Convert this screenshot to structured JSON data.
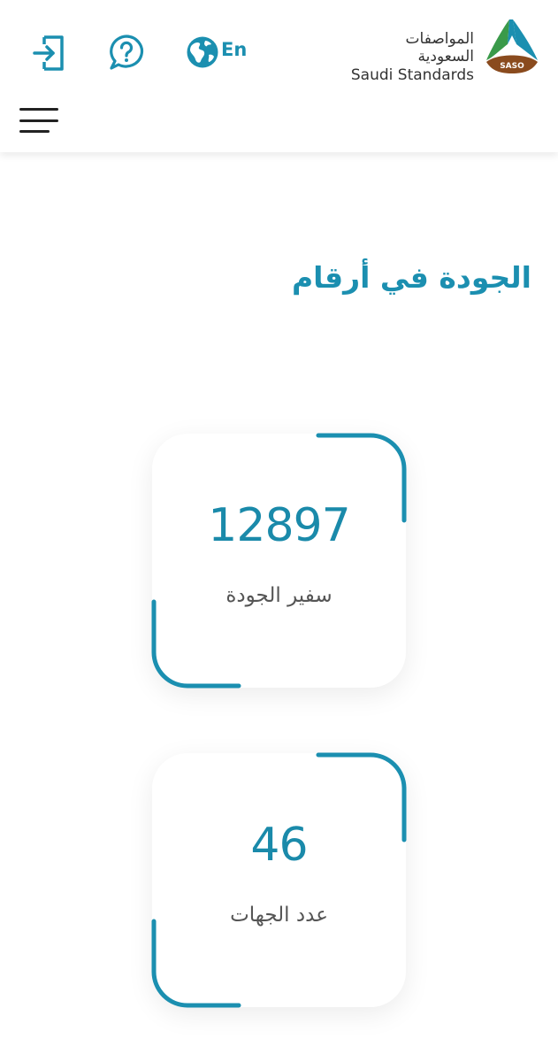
{
  "header": {
    "logo": {
      "arabic_name": "المواصفات السعودية",
      "english_name": "Saudi Standards",
      "badge_text": "SASO"
    },
    "language_toggle_label": "En",
    "icons": {
      "login": "login-icon",
      "help": "help-chat-icon",
      "language": "globe-icon",
      "menu": "hamburger-menu-icon"
    }
  },
  "section": {
    "title": "الجودة في أرقام"
  },
  "stats": [
    {
      "value": "12897",
      "label": "سفير الجودة"
    },
    {
      "value": "46",
      "label": "عدد الجهات"
    }
  ],
  "colors": {
    "accent": "#1b8fb0",
    "text_dark": "#555555",
    "logo_green": "#3a9a4a",
    "logo_blue": "#1b8fb0",
    "logo_brown": "#8a4b1e"
  }
}
